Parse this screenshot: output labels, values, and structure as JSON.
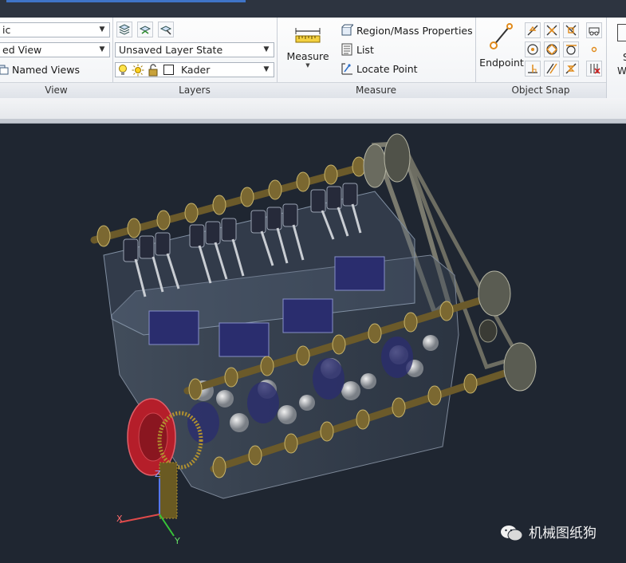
{
  "ribbon": {
    "view_panel": {
      "title": "View",
      "style_combo": "ic",
      "view_combo": "ed View",
      "named_views": "Named Views"
    },
    "layers_panel": {
      "title": "Layers",
      "layer_state": "Unsaved Layer State",
      "current_layer": "Kader"
    },
    "measure_panel": {
      "title": "Measure",
      "measure_label": "Measure",
      "region_mass": "Region/Mass Properties",
      "list": "List",
      "locate_point": "Locate Point"
    },
    "osnap_panel": {
      "title": "Object Snap",
      "endpoint_label": "Endpoint"
    },
    "cut_off": {
      "line1": "S",
      "line2": "W"
    }
  },
  "viewport": {
    "ucs_axes": {
      "x": "X",
      "y": "Y",
      "z": "Z"
    }
  },
  "watermark": {
    "text": "机械图纸狗"
  },
  "colors": {
    "viewport_bg": "#1f2631",
    "camshaft": "#6b5a2a",
    "piston": "#2a2d6e",
    "flywheel": "#b51e2a",
    "ucs_x": "#e04a4a",
    "ucs_y": "#37c437",
    "ucs_z": "#5577ff"
  }
}
